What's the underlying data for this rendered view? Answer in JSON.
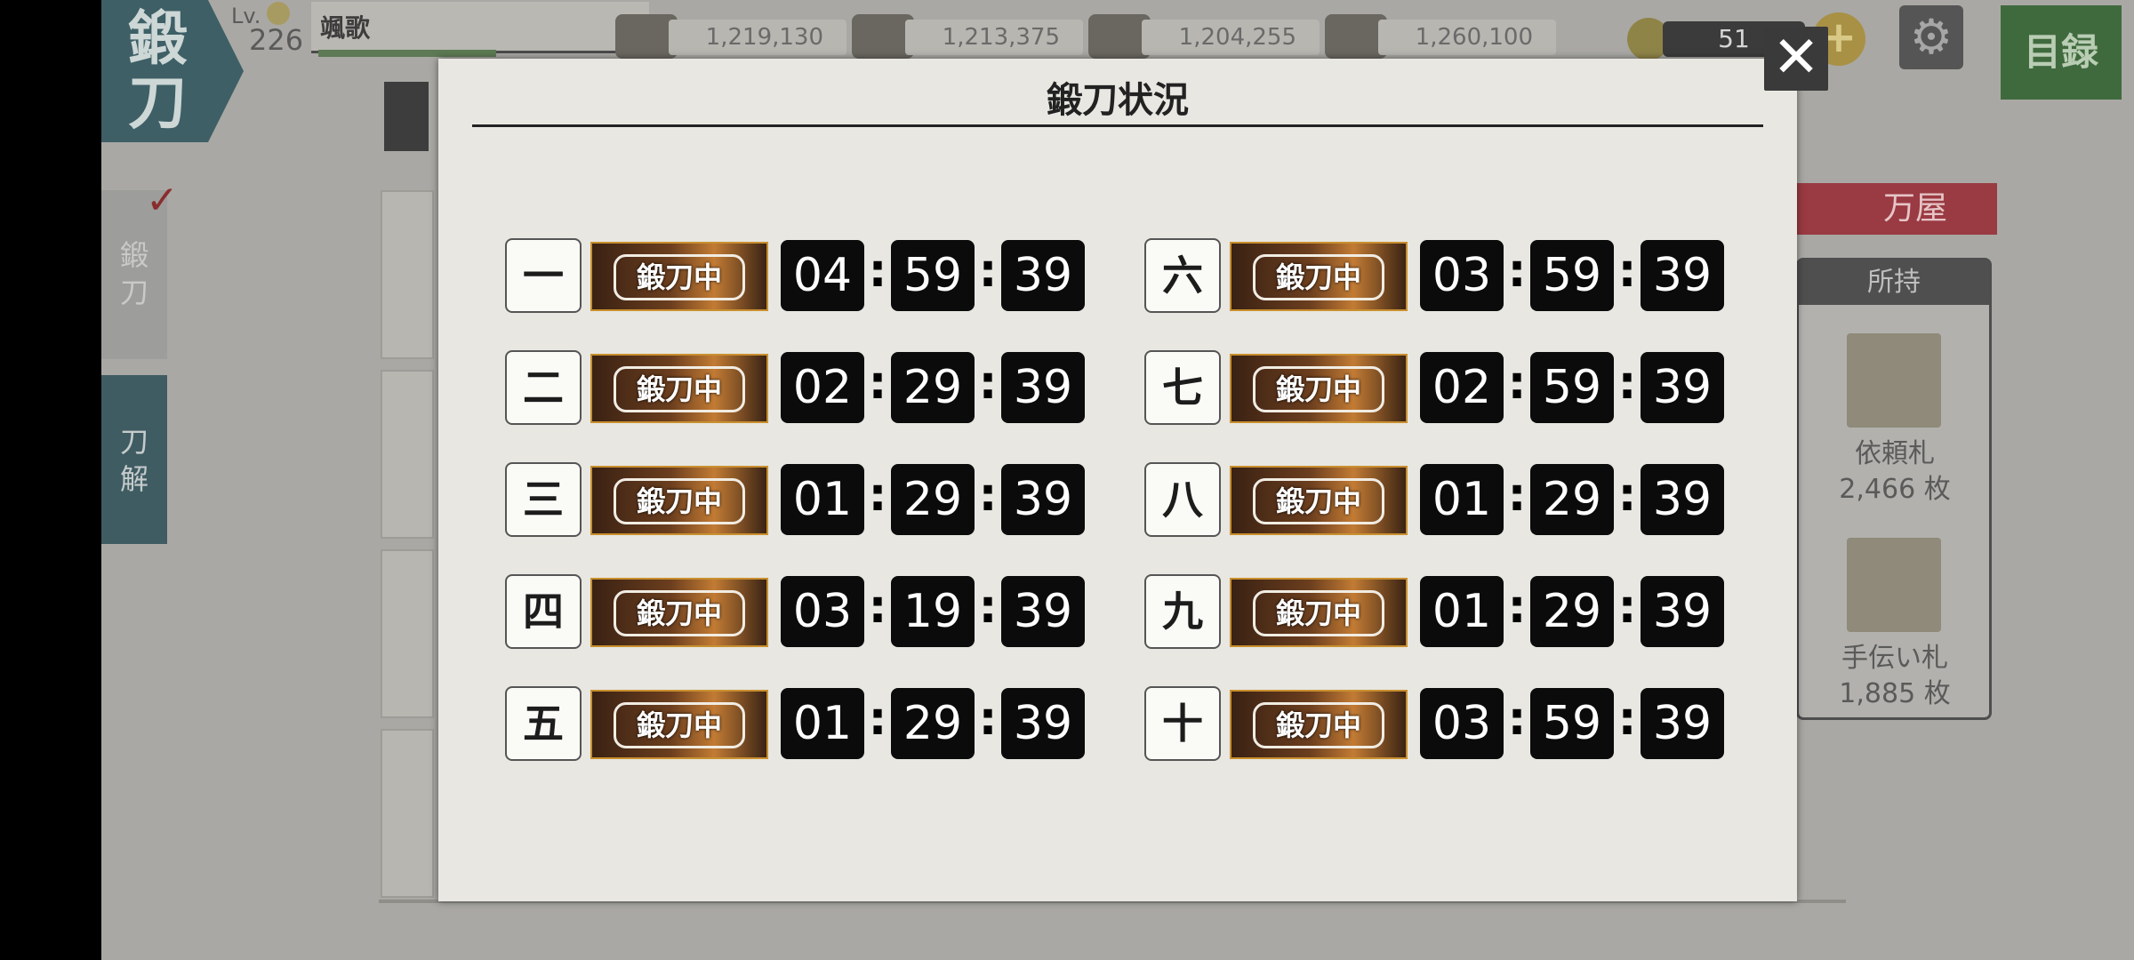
{
  "header": {
    "screen_badge": [
      "鍛",
      "刀"
    ],
    "level_label": "Lv.",
    "level": "226",
    "player_name": "颯歌"
  },
  "resources": [
    {
      "icon": "charcoal-icon",
      "value": "1,219,130"
    },
    {
      "icon": "tamahagane-icon",
      "value": "1,213,375"
    },
    {
      "icon": "cooling-material-icon",
      "value": "1,204,255"
    },
    {
      "icon": "whetstone-icon",
      "value": "1,260,100"
    }
  ],
  "gold": {
    "icon": "koban-coin-icon",
    "value": "51"
  },
  "buttons": {
    "plus": "+",
    "settings": "⚙",
    "catalog": "目録",
    "close": "✕"
  },
  "side_tabs": [
    {
      "label": [
        "鍛",
        "刀"
      ],
      "active": true
    },
    {
      "label": [
        "刀",
        "解"
      ],
      "active": false
    }
  ],
  "shop": {
    "label": "万屋"
  },
  "inventory": {
    "header": "所持",
    "items": [
      {
        "name": "依頼札",
        "count": "2,466 枚"
      },
      {
        "name": "手伝い札",
        "count": "1,885 枚"
      }
    ]
  },
  "modal": {
    "title": "鍛刀状況",
    "slots": [
      {
        "num": "一",
        "status": "鍛刀中",
        "hh": "04",
        "mm": "59",
        "ss": "39"
      },
      {
        "num": "二",
        "status": "鍛刀中",
        "hh": "02",
        "mm": "29",
        "ss": "39"
      },
      {
        "num": "三",
        "status": "鍛刀中",
        "hh": "01",
        "mm": "29",
        "ss": "39"
      },
      {
        "num": "四",
        "status": "鍛刀中",
        "hh": "03",
        "mm": "19",
        "ss": "39"
      },
      {
        "num": "五",
        "status": "鍛刀中",
        "hh": "01",
        "mm": "29",
        "ss": "39"
      },
      {
        "num": "六",
        "status": "鍛刀中",
        "hh": "03",
        "mm": "59",
        "ss": "39"
      },
      {
        "num": "七",
        "status": "鍛刀中",
        "hh": "02",
        "mm": "59",
        "ss": "39"
      },
      {
        "num": "八",
        "status": "鍛刀中",
        "hh": "01",
        "mm": "29",
        "ss": "39"
      },
      {
        "num": "九",
        "status": "鍛刀中",
        "hh": "01",
        "mm": "29",
        "ss": "39"
      },
      {
        "num": "十",
        "status": "鍛刀中",
        "hh": "03",
        "mm": "59",
        "ss": "39"
      }
    ],
    "separator": ":"
  }
}
